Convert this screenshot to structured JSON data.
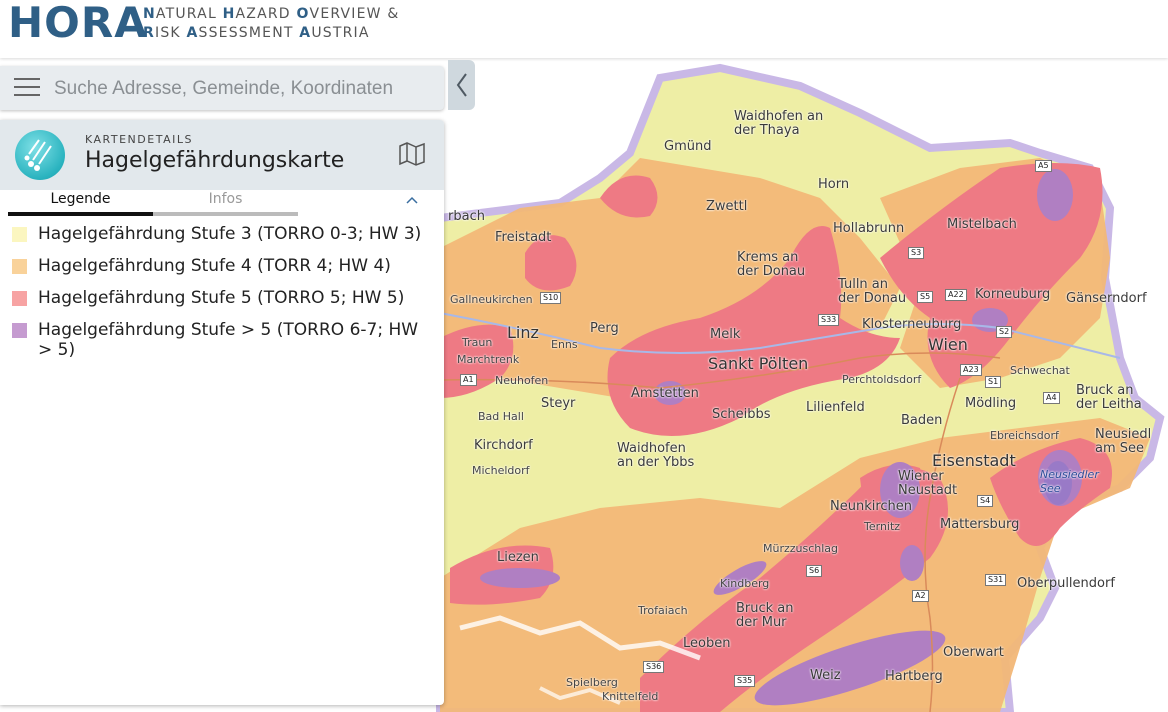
{
  "header": {
    "logo": "HORA",
    "tagline_line1": [
      "N",
      "ATURAL ",
      "H",
      "AZARD ",
      "O",
      "VERVIEW &"
    ],
    "tagline_line2": [
      "R",
      "ISK ",
      "A",
      "SSESSMENT ",
      "A",
      "USTRIA"
    ]
  },
  "search": {
    "placeholder": "Suche Adresse, Gemeinde, Koordinaten",
    "menu_icon": "hamburger-icon"
  },
  "panel": {
    "kicker": "KARTENDETAILS",
    "title": "Hagelgefährdungskarte",
    "icon": "hail-icon",
    "map_icon": "map-icon",
    "tabs": [
      {
        "label": "Legende",
        "active": true
      },
      {
        "label": "Infos",
        "active": false
      }
    ],
    "legend": [
      {
        "label": "Hagelgefährdung Stufe 3 (TORRO 0-3; HW 3)",
        "color": "#fbf6c0"
      },
      {
        "label": "Hagelgefährdung Stufe 4 (TORR 4; HW 4)",
        "color": "#f9d29a"
      },
      {
        "label": "Hagelgefährdung Stufe 5 (TORRO 5; HW 5)",
        "color": "#f7a3a3"
      },
      {
        "label": "Hagelgefährdung Stufe > 5 (TORRO 6-7; HW > 5)",
        "color": "#c59bd0"
      }
    ]
  },
  "map": {
    "colors": {
      "stufe3": "#eeeea5",
      "stufe4": "#f2b777",
      "stufe5": "#ee7a84",
      "stufe6": "#b07fc2",
      "border": "#c9b8e6"
    },
    "places": [
      {
        "name": "Waidhofen an der Thaya",
        "lines": [
          "Waidhofen an",
          "der Thaya"
        ]
      },
      {
        "name": "Gmünd"
      },
      {
        "name": "Horn"
      },
      {
        "name": "Zwettl"
      },
      {
        "name": "Hollabrunn"
      },
      {
        "name": "Mistelbach"
      },
      {
        "name": "Freistadt"
      },
      {
        "name": "Krems an der Donau",
        "lines": [
          "Krems an",
          "der Donau"
        ]
      },
      {
        "name": "Tulln an der Donau",
        "lines": [
          "Tulln an",
          "der Donau"
        ]
      },
      {
        "name": "Korneuburg"
      },
      {
        "name": "Gänserndorf"
      },
      {
        "name": "Gallneukirchen"
      },
      {
        "name": "Linz"
      },
      {
        "name": "Perg"
      },
      {
        "name": "Melk"
      },
      {
        "name": "Klosterneuburg"
      },
      {
        "name": "Wien"
      },
      {
        "name": "Traun"
      },
      {
        "name": "Enns"
      },
      {
        "name": "Marchtrenk"
      },
      {
        "name": "Sankt Pölten"
      },
      {
        "name": "Perchtoldsdorf"
      },
      {
        "name": "Schwechat"
      },
      {
        "name": "Neuhofen"
      },
      {
        "name": "Amstetten"
      },
      {
        "name": "Bruck an der Leitha",
        "lines": [
          "Bruck an",
          "der Leitha"
        ]
      },
      {
        "name": "Steyr"
      },
      {
        "name": "Bad Hall"
      },
      {
        "name": "Scheibbs"
      },
      {
        "name": "Lilienfeld"
      },
      {
        "name": "Mödling"
      },
      {
        "name": "Baden"
      },
      {
        "name": "Ebreichsdorf"
      },
      {
        "name": "Neusiedl am See",
        "lines": [
          "Neusiedl",
          "am See"
        ]
      },
      {
        "name": "Kirchdorf"
      },
      {
        "name": "Waidhofen an der Ybbs",
        "lines": [
          "Waidhofen",
          "an der Ybbs"
        ]
      },
      {
        "name": "Micheldorf"
      },
      {
        "name": "Eisenstadt"
      },
      {
        "name": "Wiener Neustadt",
        "lines": [
          "Wiener",
          "Neustadt"
        ]
      },
      {
        "name": "Neusiedler See",
        "lines": [
          "Neusiedler",
          "See"
        ]
      },
      {
        "name": "Neunkirchen"
      },
      {
        "name": "Ternitz"
      },
      {
        "name": "Mattersburg"
      },
      {
        "name": "Liezen"
      },
      {
        "name": "Mürzzuschlag"
      },
      {
        "name": "Kindberg"
      },
      {
        "name": "Oberpullendorf"
      },
      {
        "name": "Trofaiach"
      },
      {
        "name": "Bruck an der Mur",
        "lines": [
          "Bruck an",
          "der Mur"
        ]
      },
      {
        "name": "Leoben"
      },
      {
        "name": "Oberwart"
      },
      {
        "name": "Spielberg"
      },
      {
        "name": "Knittelfeld"
      },
      {
        "name": "Weiz"
      },
      {
        "name": "Hartberg"
      },
      {
        "name": "rbach"
      }
    ],
    "roads": [
      "A5",
      "S3",
      "S10",
      "S5",
      "A22",
      "S2",
      "S33",
      "A23",
      "S1",
      "A1",
      "A4",
      "S4",
      "S6",
      "S31",
      "A2",
      "S36",
      "S35"
    ]
  }
}
